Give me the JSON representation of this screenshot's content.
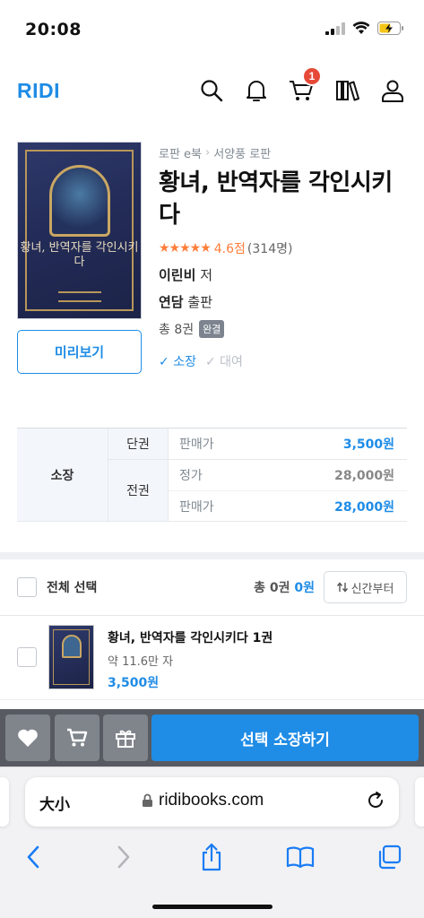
{
  "status": {
    "time": "20:08"
  },
  "header": {
    "logo": "RIDI",
    "cart_count": "1"
  },
  "book": {
    "breadcrumb": [
      "로판 e북",
      "서양풍 로판"
    ],
    "title": "황녀, 반역자를 각인시키다",
    "stars": "★★★★★",
    "score": "4.6점",
    "review_count": "(314명)",
    "author": "이린비",
    "author_suffix": "저",
    "publisher": "연담",
    "publisher_suffix": "출판",
    "volumes": "총 8권",
    "status_badge": "완결",
    "own_label": "소장",
    "rent_label": "대여",
    "preview_button": "미리보기",
    "cover_text": "황녀, 반역자를 각인시키다"
  },
  "price_table": {
    "group_label": "소장",
    "single": {
      "label": "단권",
      "price_label": "판매가",
      "price": "3,500원"
    },
    "full": {
      "label": "전권",
      "list_price_label": "정가",
      "list_price": "28,000원",
      "sale_price_label": "판매가",
      "sale_price": "28,000원"
    }
  },
  "selection": {
    "select_all": "전체 선택",
    "total_prefix": "총",
    "total_count": "0권",
    "total_price": "0원",
    "sort_label": "신간부터"
  },
  "items": [
    {
      "title": "황녀, 반역자를 각인시키다 1권",
      "subtitle": "약 11.6만 자",
      "price": "3,500원"
    }
  ],
  "actions": {
    "buy_button": "선택 소장하기"
  },
  "browser": {
    "text_size": "大小",
    "url": "ridibooks.com"
  },
  "colors": {
    "accent": "#1f8ce6",
    "star": "#ff7e3a",
    "badge": "#e64938",
    "action_bar": "#575b61"
  }
}
